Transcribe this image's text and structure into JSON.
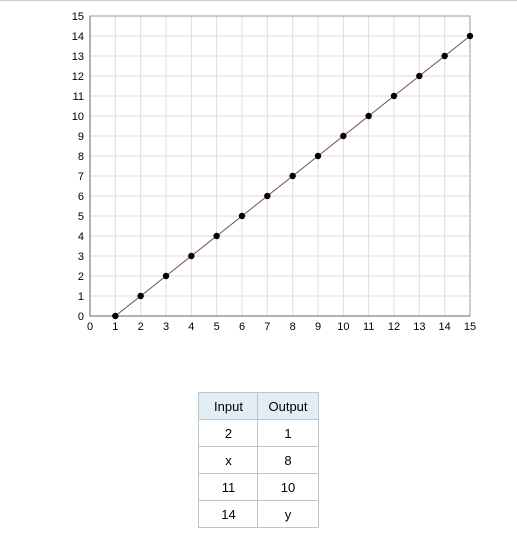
{
  "chart_data": {
    "type": "scatter",
    "x": [
      1,
      2,
      3,
      4,
      5,
      6,
      7,
      8,
      9,
      10,
      11,
      12,
      13,
      14,
      15
    ],
    "y": [
      0,
      1,
      2,
      3,
      4,
      5,
      6,
      7,
      8,
      9,
      10,
      11,
      12,
      13,
      14
    ],
    "line": true,
    "xlim": [
      0,
      15
    ],
    "ylim": [
      0,
      15
    ],
    "x_ticks": [
      0,
      1,
      2,
      3,
      4,
      5,
      6,
      7,
      8,
      9,
      10,
      11,
      12,
      13,
      14,
      15
    ],
    "y_ticks": [
      0,
      1,
      2,
      3,
      4,
      5,
      6,
      7,
      8,
      9,
      10,
      11,
      12,
      13,
      14,
      15
    ],
    "grid": true
  },
  "table": {
    "header_input": "Input",
    "header_output": "Output",
    "rows": [
      {
        "input": "2",
        "output": "1"
      },
      {
        "input": "x",
        "output": "8"
      },
      {
        "input": "11",
        "output": "10"
      },
      {
        "input": "14",
        "output": "y"
      }
    ]
  }
}
